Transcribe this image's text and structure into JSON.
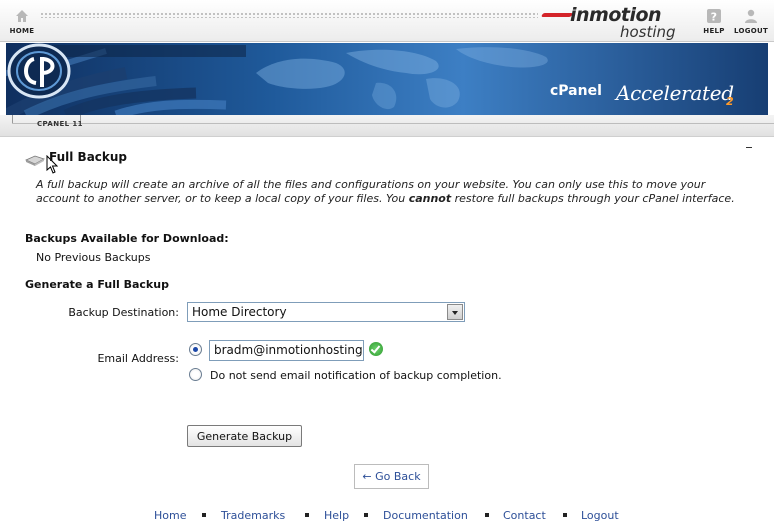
{
  "header": {
    "home_label": "HOME",
    "help_label": "HELP",
    "logout_label": "LOGOUT",
    "brand_line1": "inmotion",
    "brand_line2": "hosting",
    "brand_color": "#d4242a"
  },
  "banner": {
    "cp_word": "cPanel",
    "accelerated": "Accelerated",
    "version_mark": "2"
  },
  "strip": {
    "version_label": "CPANEL 11"
  },
  "page": {
    "title": "Full Backup",
    "description_part1": "A full backup will create an archive of all the files and configurations on your website. You can only use this to move your account to another server, or to keep a local copy of your files. You ",
    "description_bold": "cannot",
    "description_part2": " restore full backups through your cPanel interface.",
    "available_heading": "Backups Available for Download:",
    "available_value": "No Previous Backups",
    "generate_heading": "Generate a Full Backup"
  },
  "form": {
    "destination_label": "Backup Destination:",
    "destination_value": "Home Directory",
    "email_label": "Email Address:",
    "email_value": "bradm@inmotionhosting.c",
    "email_option_selected": true,
    "no_email_label": "Do not send email notification of backup completion.",
    "generate_button": "Generate Backup",
    "go_back": "← Go Back"
  },
  "footer": {
    "links": [
      "Home",
      "Trademarks",
      "Help",
      "Documentation",
      "Contact",
      "Logout"
    ]
  },
  "colors": {
    "link": "#2d4f98",
    "banner_dark": "#0f2f5f",
    "banner_light": "#3d7fc4",
    "accent_orange": "#ff9a2a"
  }
}
